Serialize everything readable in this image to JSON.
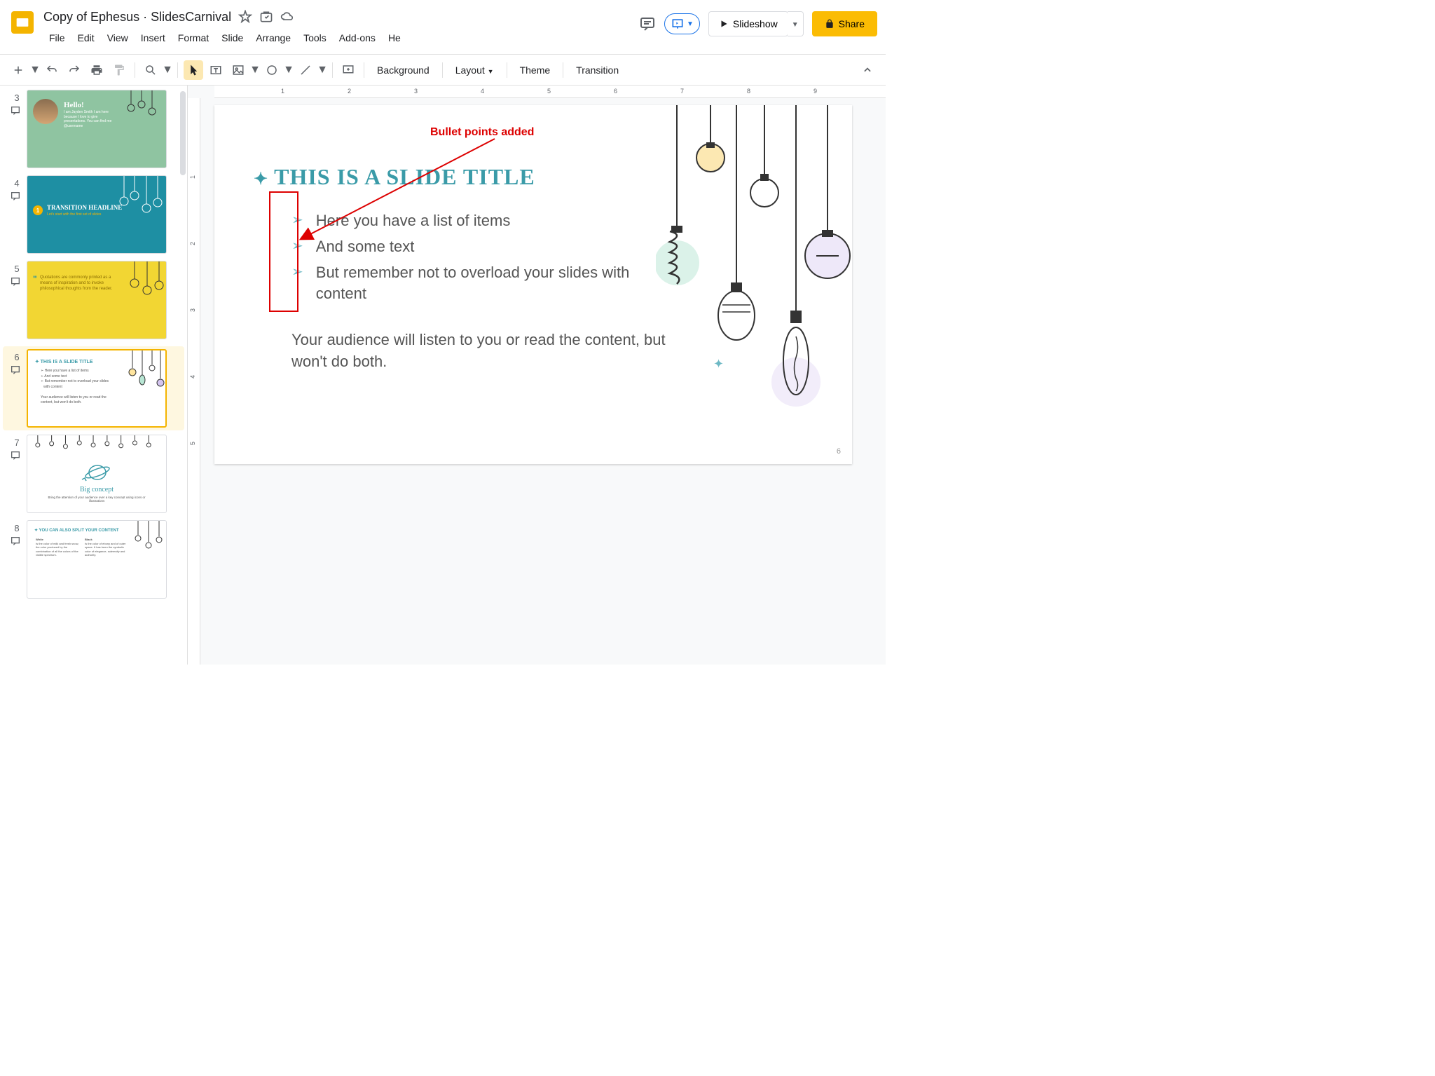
{
  "header": {
    "doc_title": "Copy of Ephesus · SlidesCarnival",
    "menu": [
      "File",
      "Edit",
      "View",
      "Insert",
      "Format",
      "Slide",
      "Arrange",
      "Tools",
      "Add-ons",
      "He"
    ],
    "slideshow": "Slideshow",
    "share": "Share"
  },
  "toolbar": {
    "background": "Background",
    "layout": "Layout",
    "theme": "Theme",
    "transition": "Transition"
  },
  "ruler_h_ticks": [
    "1",
    "2",
    "3",
    "4",
    "5",
    "6",
    "7",
    "8",
    "9"
  ],
  "ruler_v_ticks": [
    "1",
    "2",
    "3",
    "4",
    "5"
  ],
  "slide": {
    "title": "This is a slide title",
    "bullets": [
      "Here you have a list of items",
      "And some text",
      "But remember not to overload your slides with content"
    ],
    "body": "Your audience will listen to you or read the content, but won't do both.",
    "page": "6"
  },
  "annotation": {
    "label": "Bullet points added"
  },
  "thumbs": [
    {
      "num": "3",
      "bg": "thumb-green",
      "title": "Hello!",
      "text": "I am Jayden Smith\nI am here because I love to give presentations.\nYou can find me @username"
    },
    {
      "num": "4",
      "bg": "thumb-blue",
      "title": "Transition Headline",
      "text": "Let's start with the first set of slides",
      "numcircle": "1"
    },
    {
      "num": "5",
      "bg": "thumb-yellow",
      "text": "Quotations are commonly printed as a means of inspiration and to invoke philosophical thoughts from the reader."
    },
    {
      "num": "6",
      "bg": "thumb-white",
      "title": "This is a slide title",
      "selected": true
    },
    {
      "num": "7",
      "bg": "thumb-white",
      "title": "Big concept",
      "text": "Bring the attention of your audience over a key concept using icons or illustrations"
    },
    {
      "num": "8",
      "bg": "thumb-white",
      "title": "You can also split your content"
    }
  ]
}
